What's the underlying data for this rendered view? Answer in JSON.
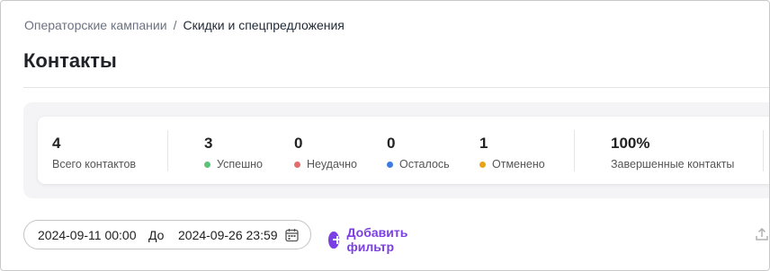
{
  "breadcrumb": {
    "parent": "Операторские кампании",
    "separator": "/",
    "current": "Скидки и спецпредложения"
  },
  "page": {
    "title": "Контакты"
  },
  "stats": {
    "total": {
      "value": "4",
      "label": "Всего контактов"
    },
    "success": {
      "value": "3",
      "label": "Успешно",
      "color": "#5cc27a"
    },
    "failed": {
      "value": "0",
      "label": "Неудачно",
      "color": "#e36d6d"
    },
    "remaining": {
      "value": "0",
      "label": "Осталось",
      "color": "#3b7be3"
    },
    "cancelled": {
      "value": "1",
      "label": "Отменено",
      "color": "#e6a416"
    },
    "completed": {
      "value": "100%",
      "label": "Завершенные контакты"
    }
  },
  "filters": {
    "date_from": "2024-09-11 00:00",
    "date_to_label": "До",
    "date_to": "2024-09-26 23:59",
    "calendar_icon": "calendar-icon",
    "add_filter_label": "Добавить фильтр",
    "add_icon": "plus-circle-icon",
    "accent": "#7b3fe4"
  },
  "toolbar": {
    "export_icon": "upload-icon"
  }
}
